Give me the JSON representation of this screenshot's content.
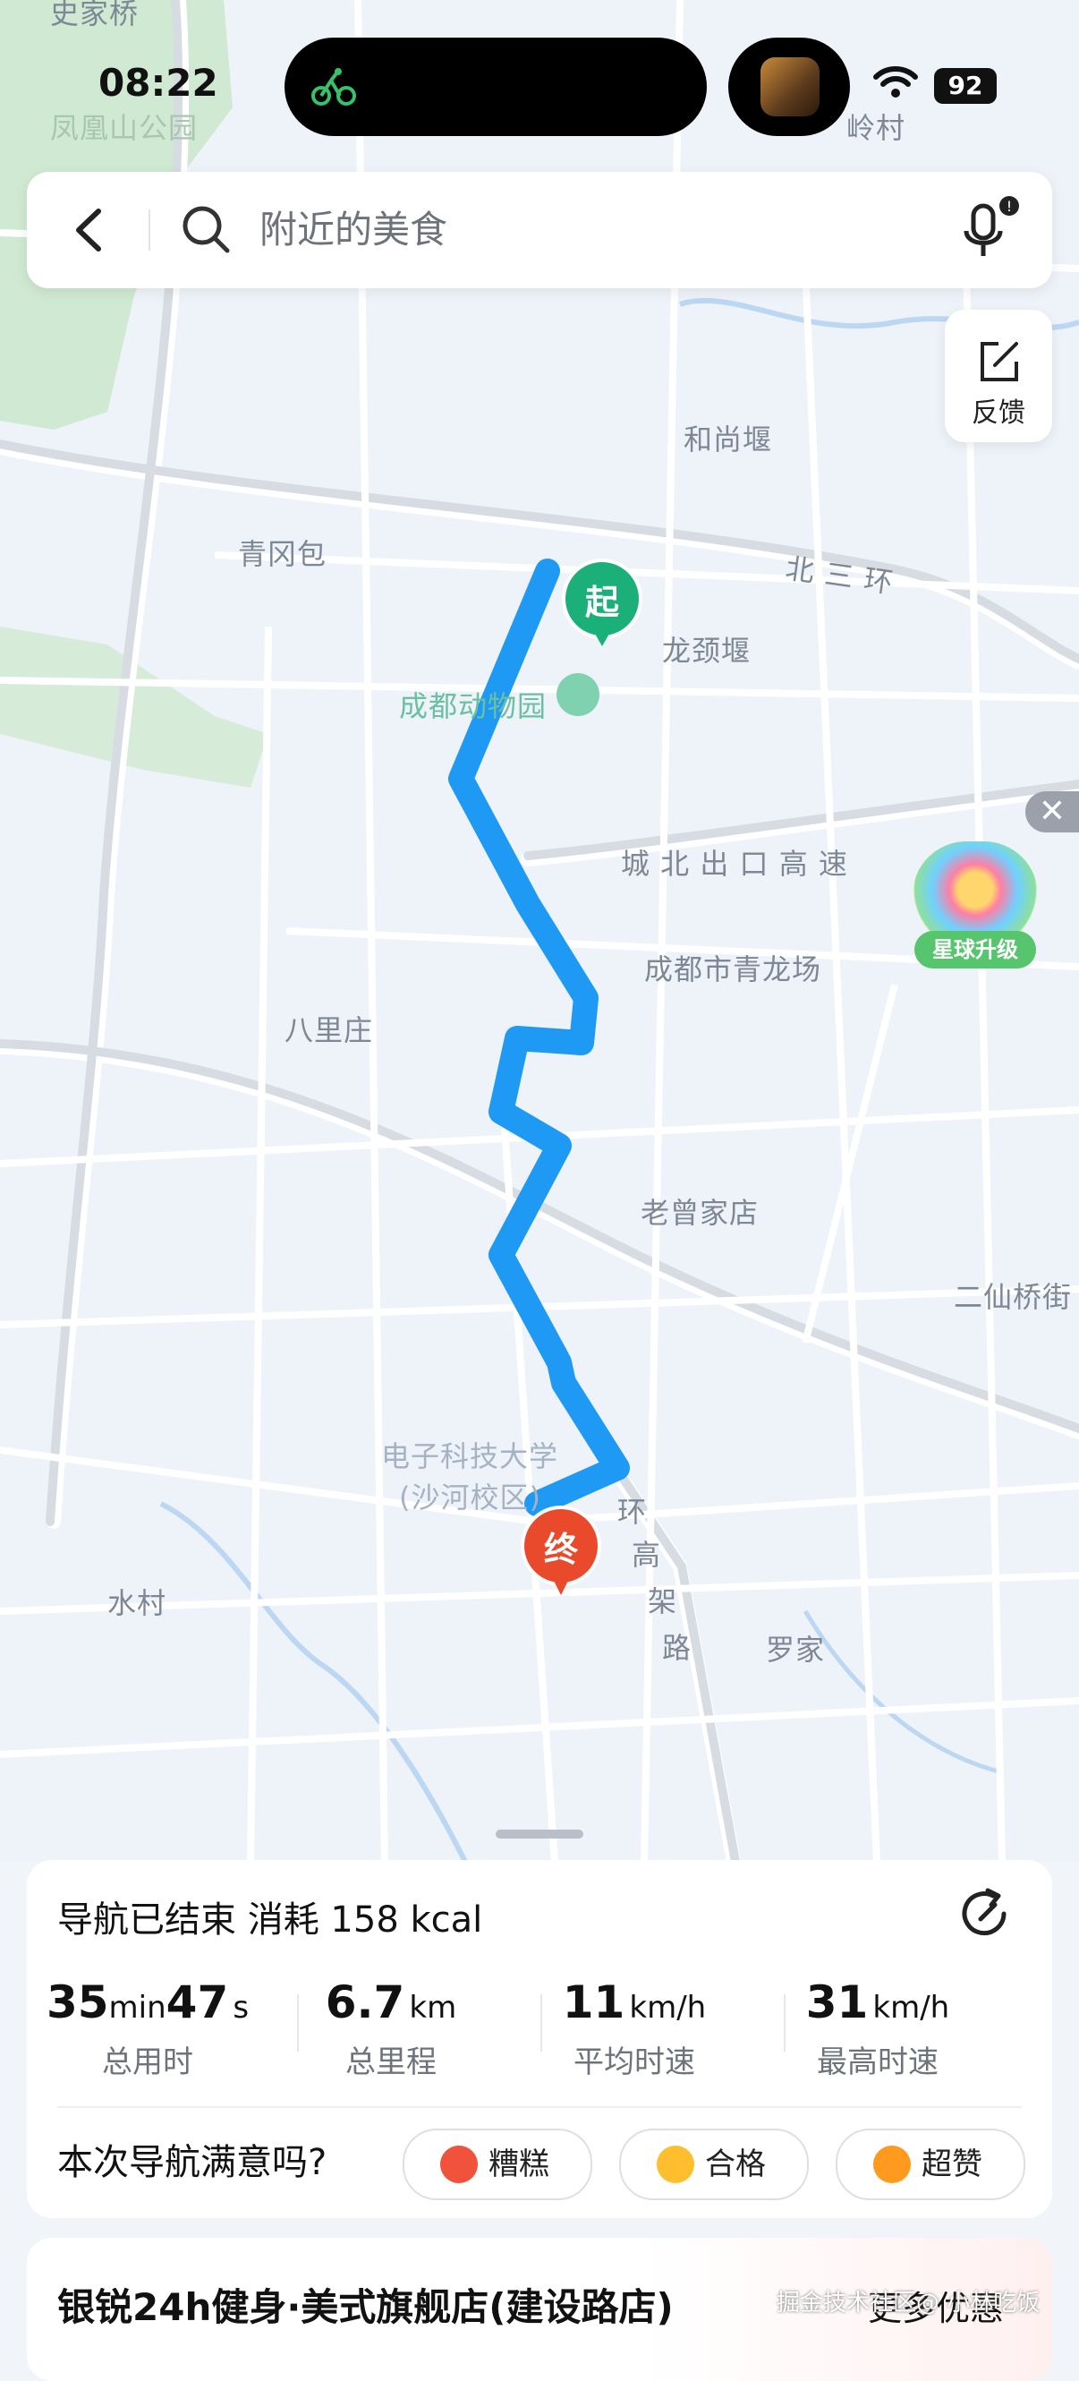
{
  "status_bar": {
    "time": "08:22",
    "battery": "92"
  },
  "search": {
    "placeholder": "附近的美食"
  },
  "feedback": {
    "label": "反馈"
  },
  "map": {
    "labels": {
      "shijiaqiao": "史家桥",
      "fenghuangshan": "凤凰山公园",
      "xxling": "岭村",
      "heshangyan": "和尚堰",
      "qinggangbao": "青冈包",
      "beisanhuan": "北 三 环",
      "longjingyan": "龙颈堰",
      "zoo": "成都动物园",
      "chengbei": "城 北 出 口 高 速",
      "qinglongchang": "成都市青龙场",
      "balizhuang": "八里庄",
      "laozengjiadian": "老曾家店",
      "erxianqiaojie": "二仙桥街",
      "uestc1": "电子科技大学",
      "uestc2": "(沙河校区)",
      "huan": "环",
      "gao": "高",
      "jia": "架",
      "lu": "路",
      "shuicun": "水村",
      "luojia": "罗家"
    },
    "start_marker": "起",
    "end_marker": "终"
  },
  "promo": {
    "label": "星球升级",
    "close": "✕"
  },
  "summary": {
    "title": "导航已结束 消耗 158 kcal",
    "stats": [
      {
        "value1": "35",
        "unit1": "min",
        "value2": "47",
        "unit2": "s",
        "label": "总用时"
      },
      {
        "value1": "6.7",
        "unit1": "km",
        "label": "总里程"
      },
      {
        "value1": "11",
        "unit1": "km/h",
        "label": "平均时速"
      },
      {
        "value1": "31",
        "unit1": "km/h",
        "label": "最高时速"
      }
    ],
    "rating_question": "本次导航满意吗?",
    "ratings": [
      {
        "label": "糟糕",
        "color": "#f0523c"
      },
      {
        "label": "合格",
        "color": "#ffbe2e"
      },
      {
        "label": "超赞",
        "color": "#ff9a1f"
      }
    ]
  },
  "ad": {
    "title": "银锐24h健身·美式旗舰店(建设路店)",
    "link": "更多优惠"
  },
  "watermark": "掘金技术社区@ 小林吃饭"
}
